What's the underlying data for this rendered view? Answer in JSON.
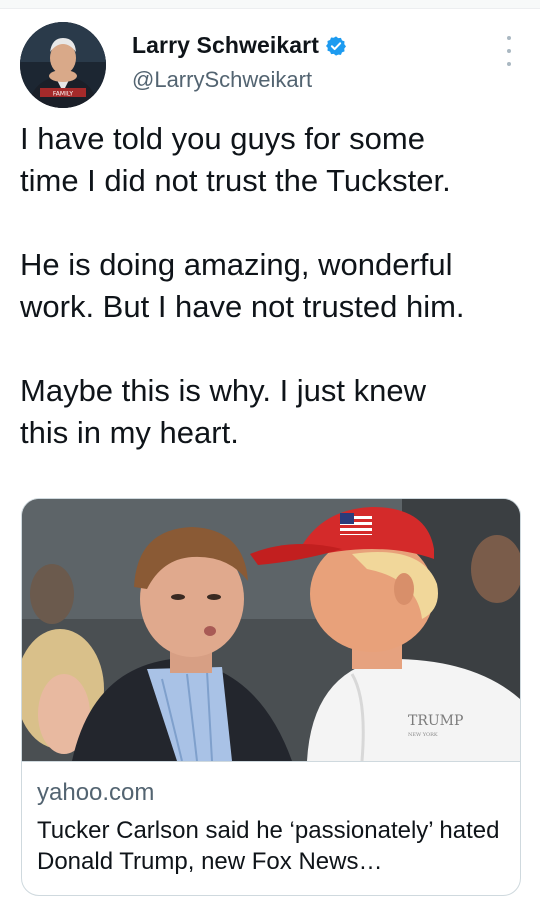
{
  "tweet": {
    "author": {
      "display_name": "Larry Schweikart",
      "handle": "@LarrySchweikart",
      "verified": true,
      "verified_icon": "verified-badge-icon",
      "avatar_badge_text": "FAMILY"
    },
    "menu_icon": "more-options-icon",
    "text": "I have told you guys for some\ntime I did not trust the Tuckster.\n\nHe is doing amazing, wonderful\nwork. But I have not trusted him.\n\nMaybe this is why. I just knew\nthis in my heart."
  },
  "link_card": {
    "domain": "yahoo.com",
    "title": "Tucker Carlson said he ‘passionately’ hated Donald Trump, new Fox News…",
    "shirt_logo_text": "TRUMP",
    "shirt_logo_subtext": "NEW YORK"
  },
  "colors": {
    "text_primary": "#0f1419",
    "text_secondary": "#536471",
    "verified_blue": "#1d9bf0",
    "border": "#cfd9de",
    "cap_red": "#d42a2a"
  }
}
